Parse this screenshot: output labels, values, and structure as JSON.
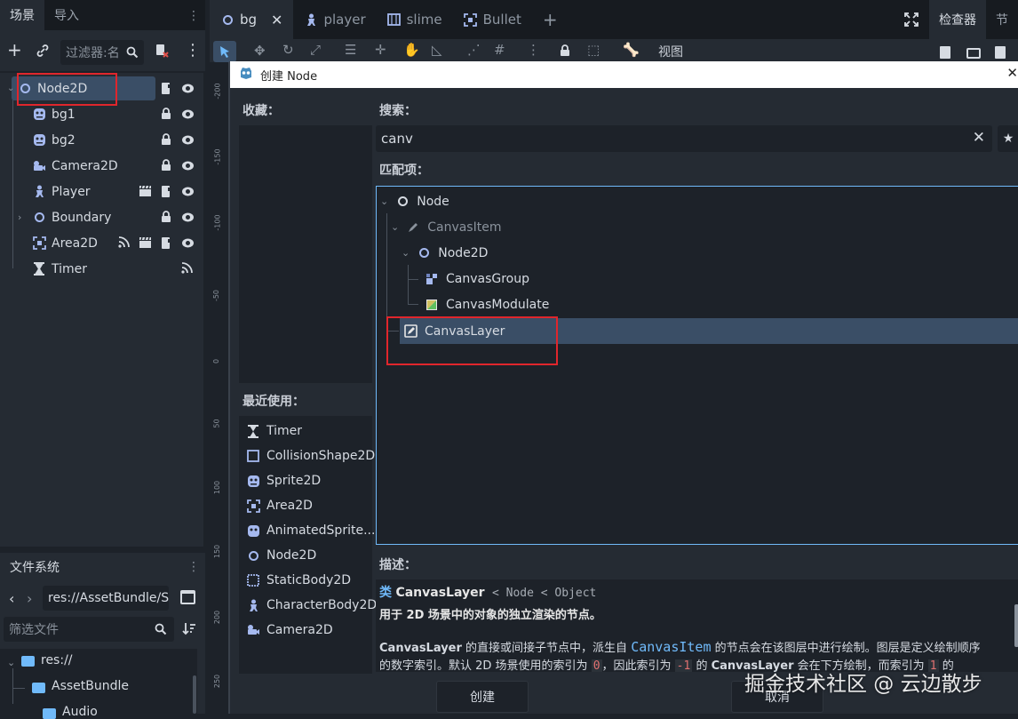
{
  "left_tabs": {
    "scene": "场景",
    "import": "导入"
  },
  "scene_filter": {
    "placeholder": "过滤器:名"
  },
  "scene_tree": [
    {
      "name": "Node2D",
      "icon": "node2d-icon"
    },
    {
      "name": "bg1",
      "icon": "sprite2d-icon"
    },
    {
      "name": "bg2",
      "icon": "sprite2d-icon"
    },
    {
      "name": "Camera2D",
      "icon": "camera2d-icon"
    },
    {
      "name": "Player",
      "icon": "characterbody2d-icon"
    },
    {
      "name": "Boundary",
      "icon": "node2d-icon"
    },
    {
      "name": "Area2D",
      "icon": "area2d-icon"
    },
    {
      "name": "Timer",
      "icon": "timer-icon"
    }
  ],
  "filesystem": {
    "tab": "文件系统",
    "path": "res://AssetBundle/S",
    "filter_placeholder": "筛选文件",
    "items": [
      "res://",
      "AssetBundle",
      "Audio"
    ]
  },
  "editor_tabs": [
    "bg",
    "player",
    "slime",
    "Bullet"
  ],
  "toolbar": {
    "view": "视图"
  },
  "right_tabs": {
    "inspector": "检查器",
    "node": "节"
  },
  "ruler": [
    "-200",
    "-150",
    "-100",
    "-50",
    "0",
    "50",
    "100",
    "150",
    "200",
    "250"
  ],
  "dialog": {
    "title": "创建 Node",
    "favorites_label": "收藏：",
    "recent_label": "最近使用：",
    "search_label": "搜索：",
    "search_value": "canv",
    "matches_label": "匹配项：",
    "description_label": "描述：",
    "recent": [
      {
        "name": "Timer",
        "icon": "timer-icon"
      },
      {
        "name": "CollisionShape2D",
        "icon": "collisionshape2d-icon"
      },
      {
        "name": "Sprite2D",
        "icon": "sprite2d-icon"
      },
      {
        "name": "Area2D",
        "icon": "area2d-icon"
      },
      {
        "name": "AnimatedSprite...",
        "icon": "animatedsprite-icon"
      },
      {
        "name": "Node2D",
        "icon": "node2d-icon"
      },
      {
        "name": "StaticBody2D",
        "icon": "staticbody2d-icon"
      },
      {
        "name": "CharacterBody2D",
        "icon": "characterbody2d-icon"
      },
      {
        "name": "Camera2D",
        "icon": "camera2d-icon"
      }
    ],
    "matches": [
      {
        "name": "Node",
        "icon": "node-icon"
      },
      {
        "name": "CanvasItem",
        "icon": "canvasitem-icon"
      },
      {
        "name": "Node2D",
        "icon": "node2d-icon"
      },
      {
        "name": "CanvasGroup",
        "icon": "canvasgroup-icon"
      },
      {
        "name": "CanvasModulate",
        "icon": "canvasmodulate-icon"
      },
      {
        "name": "CanvasLayer",
        "icon": "canvaslayer-icon"
      }
    ],
    "desc": {
      "kind": "类",
      "class": "CanvasLayer",
      "inherits": "< Node < Object",
      "brief": "用于 2D 场景中的对象的独立渲染的节点。",
      "body1_a": "CanvasLayer",
      "body1_b": " 的直接或间接子节点中，派生自 ",
      "body1_c": "CanvasItem",
      "body1_d": " 的节点会在该图层中进行绘制。图层是定义绘制顺序",
      "body2_a": "的数字索引。默认 2D 场景使用的索引为 ",
      "body2_b": "0",
      "body2_c": "，因此索引为 ",
      "body2_d": "-1",
      "body2_e": " 的 ",
      "body2_f": "CanvasLayer",
      "body2_g": " 会在下方绘制，而索引为 ",
      "body2_h": "1",
      "body2_i": " 的"
    },
    "create_button": "创建",
    "cancel_button": "取消"
  },
  "watermark": "掘金技术社区 @ 云边散步",
  "colors": {
    "accent": "#70bafa",
    "highlight": "#e0262c",
    "panel": "#252b33"
  }
}
